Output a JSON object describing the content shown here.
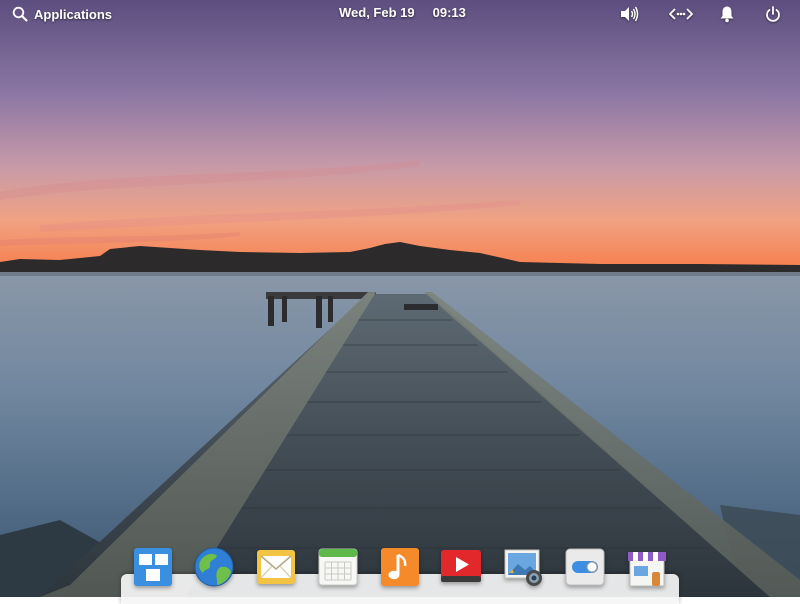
{
  "panel": {
    "applications_label": "Applications",
    "date": "Wed, Feb 19",
    "time": "09:13",
    "indicators": [
      "volume-icon",
      "network-icon",
      "notifications-icon",
      "power-icon"
    ]
  },
  "dock": {
    "apps": [
      {
        "name": "Multitasking View",
        "icon": "multitasking-icon"
      },
      {
        "name": "Web Browser",
        "icon": "globe-icon"
      },
      {
        "name": "Mail",
        "icon": "mail-icon"
      },
      {
        "name": "Calendar",
        "icon": "calendar-icon"
      },
      {
        "name": "Music",
        "icon": "music-icon"
      },
      {
        "name": "Videos",
        "icon": "videos-icon"
      },
      {
        "name": "Photos",
        "icon": "photos-icon"
      },
      {
        "name": "System Settings",
        "icon": "settings-icon"
      },
      {
        "name": "AppCenter",
        "icon": "appcenter-icon"
      }
    ]
  },
  "colors": {
    "sky_top": "#5d4f80",
    "sky_mid": "#a48cae",
    "horizon": "#f6875a",
    "water": "#7f93a4",
    "dock_bg": "#f5f5f5"
  }
}
